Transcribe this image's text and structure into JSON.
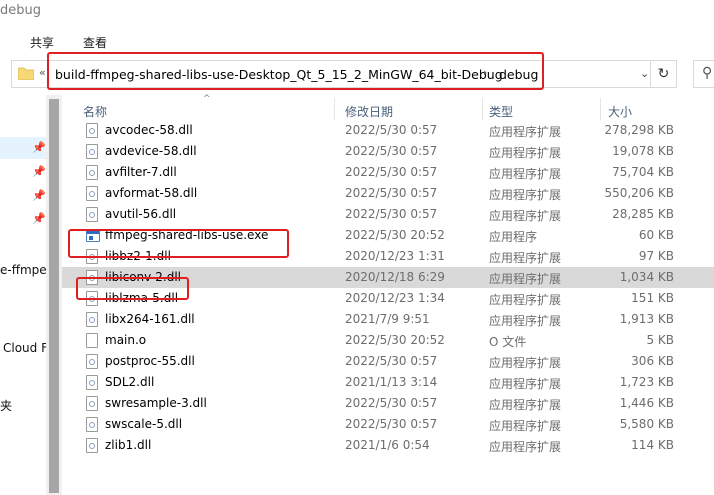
{
  "window": {
    "title": "debug"
  },
  "ribbon": {
    "tabs": [
      "共享",
      "查看"
    ]
  },
  "address": {
    "overflow": "«",
    "crumbs": [
      "build-ffmpeg-shared-libs-use-Desktop_Qt_5_15_2_MinGW_64_bit-Debug",
      "debug"
    ],
    "separator": "›",
    "dropdown": "⌄",
    "refresh": "↻",
    "search_glyph": "⚲"
  },
  "nav": {
    "pins": [
      "📌",
      "📌",
      "📌",
      "📌"
    ],
    "labels": [
      "e-ffmpe",
      "Cloud F",
      "夹"
    ]
  },
  "columns": {
    "name": "名称",
    "date": "修改日期",
    "type": "类型",
    "size": "大小",
    "sort": "^"
  },
  "files": [
    {
      "name": "avcodec-58.dll",
      "date": "2022/5/30 0:57",
      "type": "应用程序扩展",
      "size": "278,298 KB",
      "icon": "dll"
    },
    {
      "name": "avdevice-58.dll",
      "date": "2022/5/30 0:57",
      "type": "应用程序扩展",
      "size": "19,078 KB",
      "icon": "dll"
    },
    {
      "name": "avfilter-7.dll",
      "date": "2022/5/30 0:57",
      "type": "应用程序扩展",
      "size": "75,704 KB",
      "icon": "dll"
    },
    {
      "name": "avformat-58.dll",
      "date": "2022/5/30 0:57",
      "type": "应用程序扩展",
      "size": "550,206 KB",
      "icon": "dll"
    },
    {
      "name": "avutil-56.dll",
      "date": "2022/5/30 0:57",
      "type": "应用程序扩展",
      "size": "28,285 KB",
      "icon": "dll"
    },
    {
      "name": "ffmpeg-shared-libs-use.exe",
      "date": "2022/5/30 20:52",
      "type": "应用程序",
      "size": "60 KB",
      "icon": "exe"
    },
    {
      "name": "libbz2-1.dll",
      "date": "2020/12/23 1:31",
      "type": "应用程序扩展",
      "size": "97 KB",
      "icon": "dll"
    },
    {
      "name": "libiconv-2.dll",
      "date": "2020/12/18 6:29",
      "type": "应用程序扩展",
      "size": "1,034 KB",
      "icon": "dll"
    },
    {
      "name": "liblzma-5.dll",
      "date": "2020/12/23 1:34",
      "type": "应用程序扩展",
      "size": "151 KB",
      "icon": "dll"
    },
    {
      "name": "libx264-161.dll",
      "date": "2021/7/9 9:51",
      "type": "应用程序扩展",
      "size": "1,913 KB",
      "icon": "dll"
    },
    {
      "name": "main.o",
      "date": "2022/5/30 20:52",
      "type": "O 文件",
      "size": "5 KB",
      "icon": "file"
    },
    {
      "name": "postproc-55.dll",
      "date": "2022/5/30 0:57",
      "type": "应用程序扩展",
      "size": "306 KB",
      "icon": "dll"
    },
    {
      "name": "SDL2.dll",
      "date": "2021/1/13 3:14",
      "type": "应用程序扩展",
      "size": "1,723 KB",
      "icon": "dll"
    },
    {
      "name": "swresample-3.dll",
      "date": "2022/5/30 0:57",
      "type": "应用程序扩展",
      "size": "1,446 KB",
      "icon": "dll"
    },
    {
      "name": "swscale-5.dll",
      "date": "2022/5/30 0:57",
      "type": "应用程序扩展",
      "size": "5,580 KB",
      "icon": "dll"
    },
    {
      "name": "zlib1.dll",
      "date": "2021/1/6 0:54",
      "type": "应用程序扩展",
      "size": "114 KB",
      "icon": "dll"
    }
  ],
  "selected_file": "libiconv-2.dll",
  "colors": {
    "highlight": "#e02020",
    "selected_row": "#d9d9d9"
  }
}
